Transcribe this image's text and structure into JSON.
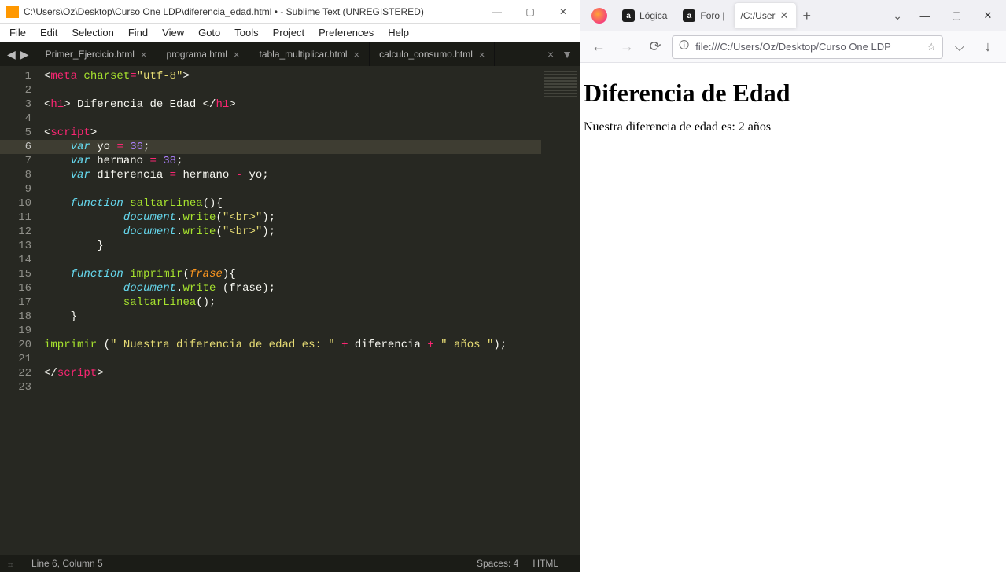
{
  "sublime": {
    "title": "C:\\Users\\Oz\\Desktop\\Curso One LDP\\diferencia_edad.html • - Sublime Text (UNREGISTERED)",
    "menu": [
      "File",
      "Edit",
      "Selection",
      "Find",
      "View",
      "Goto",
      "Tools",
      "Project",
      "Preferences",
      "Help"
    ],
    "tabs": [
      "Primer_Ejercicio.html",
      "programa.html",
      "tabla_multiplicar.html",
      "calculo_consumo.html"
    ],
    "lineCount": 23,
    "activeLine": 6,
    "status": {
      "left": "Line 6, Column 5",
      "spaces": "Spaces: 4",
      "lang": "HTML"
    }
  },
  "browser": {
    "tabs": [
      {
        "label": "Lógica",
        "favicon": "a",
        "active": false
      },
      {
        "label": "Foro |",
        "favicon": "a",
        "active": false
      },
      {
        "label": "/C:/User",
        "favicon": "",
        "active": true
      }
    ],
    "url": "file:///C:/Users/Oz/Desktop/Curso One LDP",
    "page": {
      "heading": "Diferencia de Edad",
      "text": "Nuestra diferencia de edad es: 2 años"
    }
  }
}
